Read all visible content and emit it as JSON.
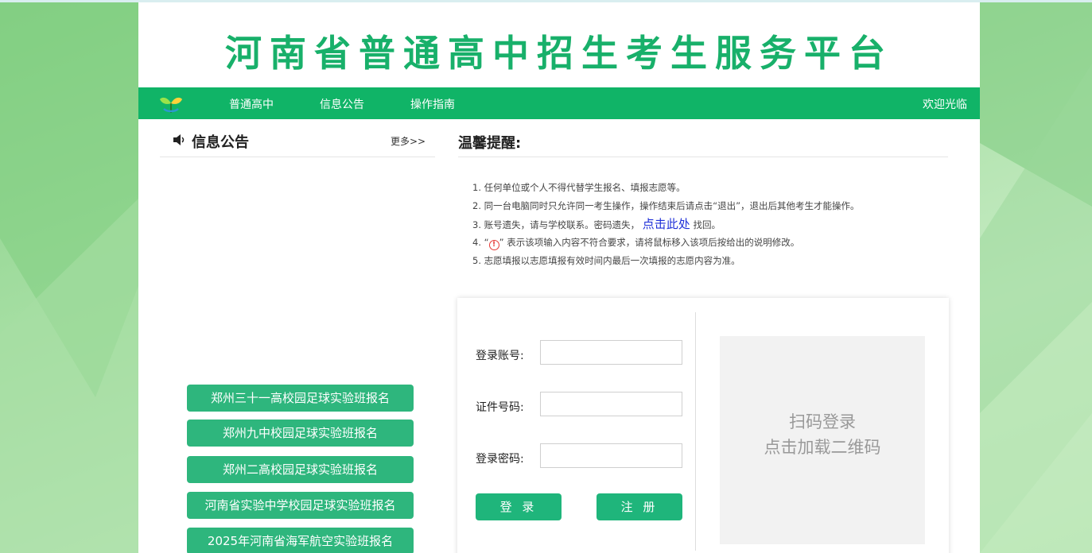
{
  "header": {
    "site_title": "河南省普通高中招生考生服务平台"
  },
  "nav": {
    "items": [
      {
        "label": "普通高中"
      },
      {
        "label": "信息公告"
      },
      {
        "label": "操作指南"
      }
    ],
    "welcome": "欢迎光临"
  },
  "news": {
    "title": "信息公告",
    "more": "更多>>"
  },
  "reminder": {
    "title": "温馨提醒:",
    "tip1": "1. 任何单位或个人不得代替学生报名、填报志愿等。",
    "tip2": "2. 同一台电脑同时只允许同一考生操作，操作结束后请点击“退出”，退出后其他考生才能操作。",
    "tip3_prefix": "3. 账号遗失，请与学校联系。密码遗失，",
    "tip3_link": "点击此处",
    "tip3_suffix": "找回。",
    "tip4_prefix": "4. “",
    "tip4_icon": "!",
    "tip4_suffix": "” 表示该项输入内容不符合要求，请将鼠标移入该项后按给出的说明修改。",
    "tip5": "5. 志愿填报以志愿填报有效时间内最后一次填报的志愿内容为准。"
  },
  "signup_buttons": [
    {
      "label": "郑州三十一高校园足球实验班报名"
    },
    {
      "label": "郑州九中校园足球实验班报名"
    },
    {
      "label": "郑州二高校园足球实验班报名"
    },
    {
      "label": "河南省实验中学校园足球实验班报名"
    },
    {
      "label": "2025年河南省海军航空实验班报名"
    }
  ],
  "login": {
    "account_label": "登录账号:",
    "account_value": "",
    "id_label": "证件号码:",
    "id_value": "",
    "password_label": "登录密码:",
    "password_value": "",
    "login_button": "登 录",
    "register_button": "注 册"
  },
  "qr": {
    "line1": "扫码登录",
    "line2": "点击加载二维码"
  },
  "colors": {
    "brand_green": "#10b467",
    "title_green": "#18b06a",
    "button_green": "#2eb67d"
  }
}
